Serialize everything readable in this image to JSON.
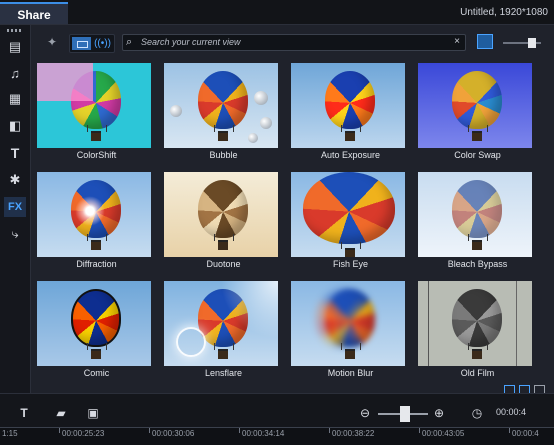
{
  "app": {
    "tab": "Share",
    "project_info": "Untitled, 1920*1080"
  },
  "sidebar": {
    "items": [
      {
        "icon": "media-icon"
      },
      {
        "icon": "audio-icon"
      },
      {
        "icon": "instant-project-icon"
      },
      {
        "icon": "transition-icon"
      },
      {
        "icon": "title-icon",
        "glyph": "T"
      },
      {
        "icon": "graphics-icon"
      },
      {
        "icon": "fx-icon",
        "label": "FX",
        "active": true
      },
      {
        "icon": "path-icon"
      }
    ]
  },
  "toolbar": {
    "search_placeholder": "Search your current view",
    "clear_glyph": "×"
  },
  "effects": [
    {
      "label": "ColorShift"
    },
    {
      "label": "Bubble"
    },
    {
      "label": "Auto Exposure"
    },
    {
      "label": "Color Swap"
    },
    {
      "label": "Diffraction"
    },
    {
      "label": "Duotone"
    },
    {
      "label": "Fish Eye"
    },
    {
      "label": "Bleach Bypass"
    },
    {
      "label": "Comic"
    },
    {
      "label": "Lensflare"
    },
    {
      "label": "Motion Blur"
    },
    {
      "label": "Old Film"
    }
  ],
  "timeline": {
    "timecode_partial": "00:00:4",
    "ticks": [
      "1:15",
      "00:00:25:23",
      "00:00:30:06",
      "00:00:34:14",
      "00:00:38:22",
      "00:00:43:05",
      "00:00:4"
    ]
  },
  "colors": {
    "accent": "#4aa3ff",
    "panel": "#1f222b",
    "dark": "#121418"
  }
}
